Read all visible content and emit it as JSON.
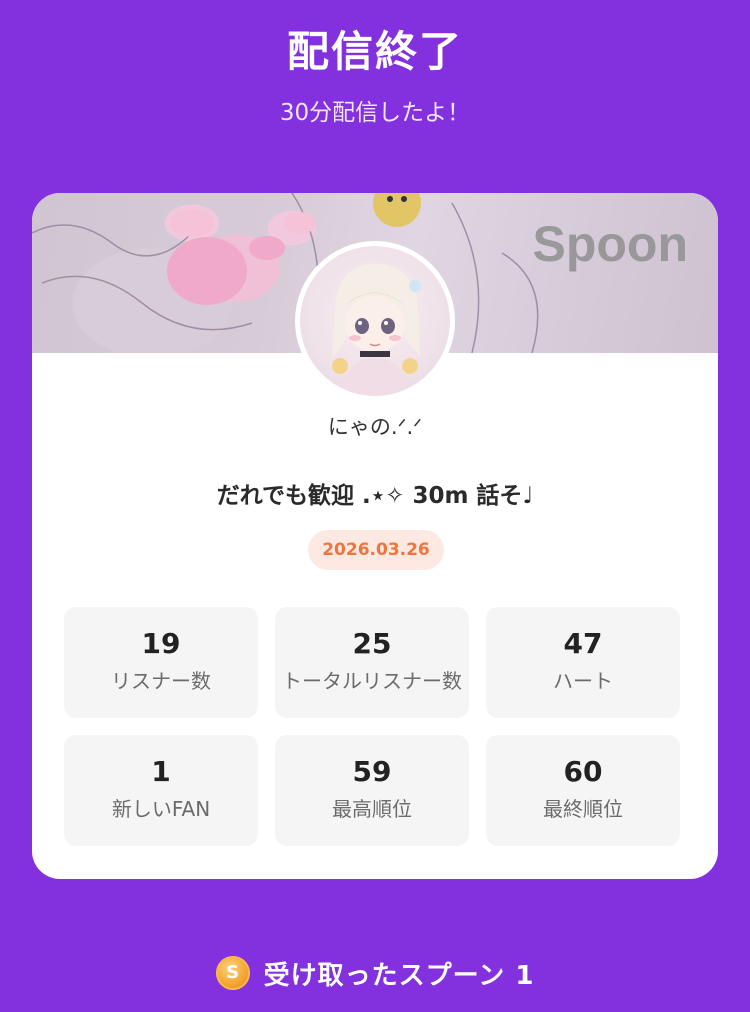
{
  "header": {
    "title": "配信終了",
    "subtitle": "30分配信したよ！"
  },
  "card": {
    "brand": "Spoon",
    "username": "にゃの.ᐟ.ᐟ",
    "live_title": "だれでも歓迎 .⋆✧ 30m  話そ♩",
    "date": "2026.03.26",
    "stats": [
      {
        "value": "19",
        "label": "リスナー数"
      },
      {
        "value": "25",
        "label": "トータルリスナー数"
      },
      {
        "value": "47",
        "label": "ハート"
      },
      {
        "value": "1",
        "label": "新しいFAN"
      },
      {
        "value": "59",
        "label": "最高順位"
      },
      {
        "value": "60",
        "label": "最終順位"
      }
    ]
  },
  "footer": {
    "coin_icon": "spoon-coin-icon",
    "coin_letter": "S",
    "text": "受け取ったスプーン  1"
  },
  "colors": {
    "background": "#8330df",
    "date_text": "#f0743d",
    "date_bg": "#fde9e1"
  }
}
